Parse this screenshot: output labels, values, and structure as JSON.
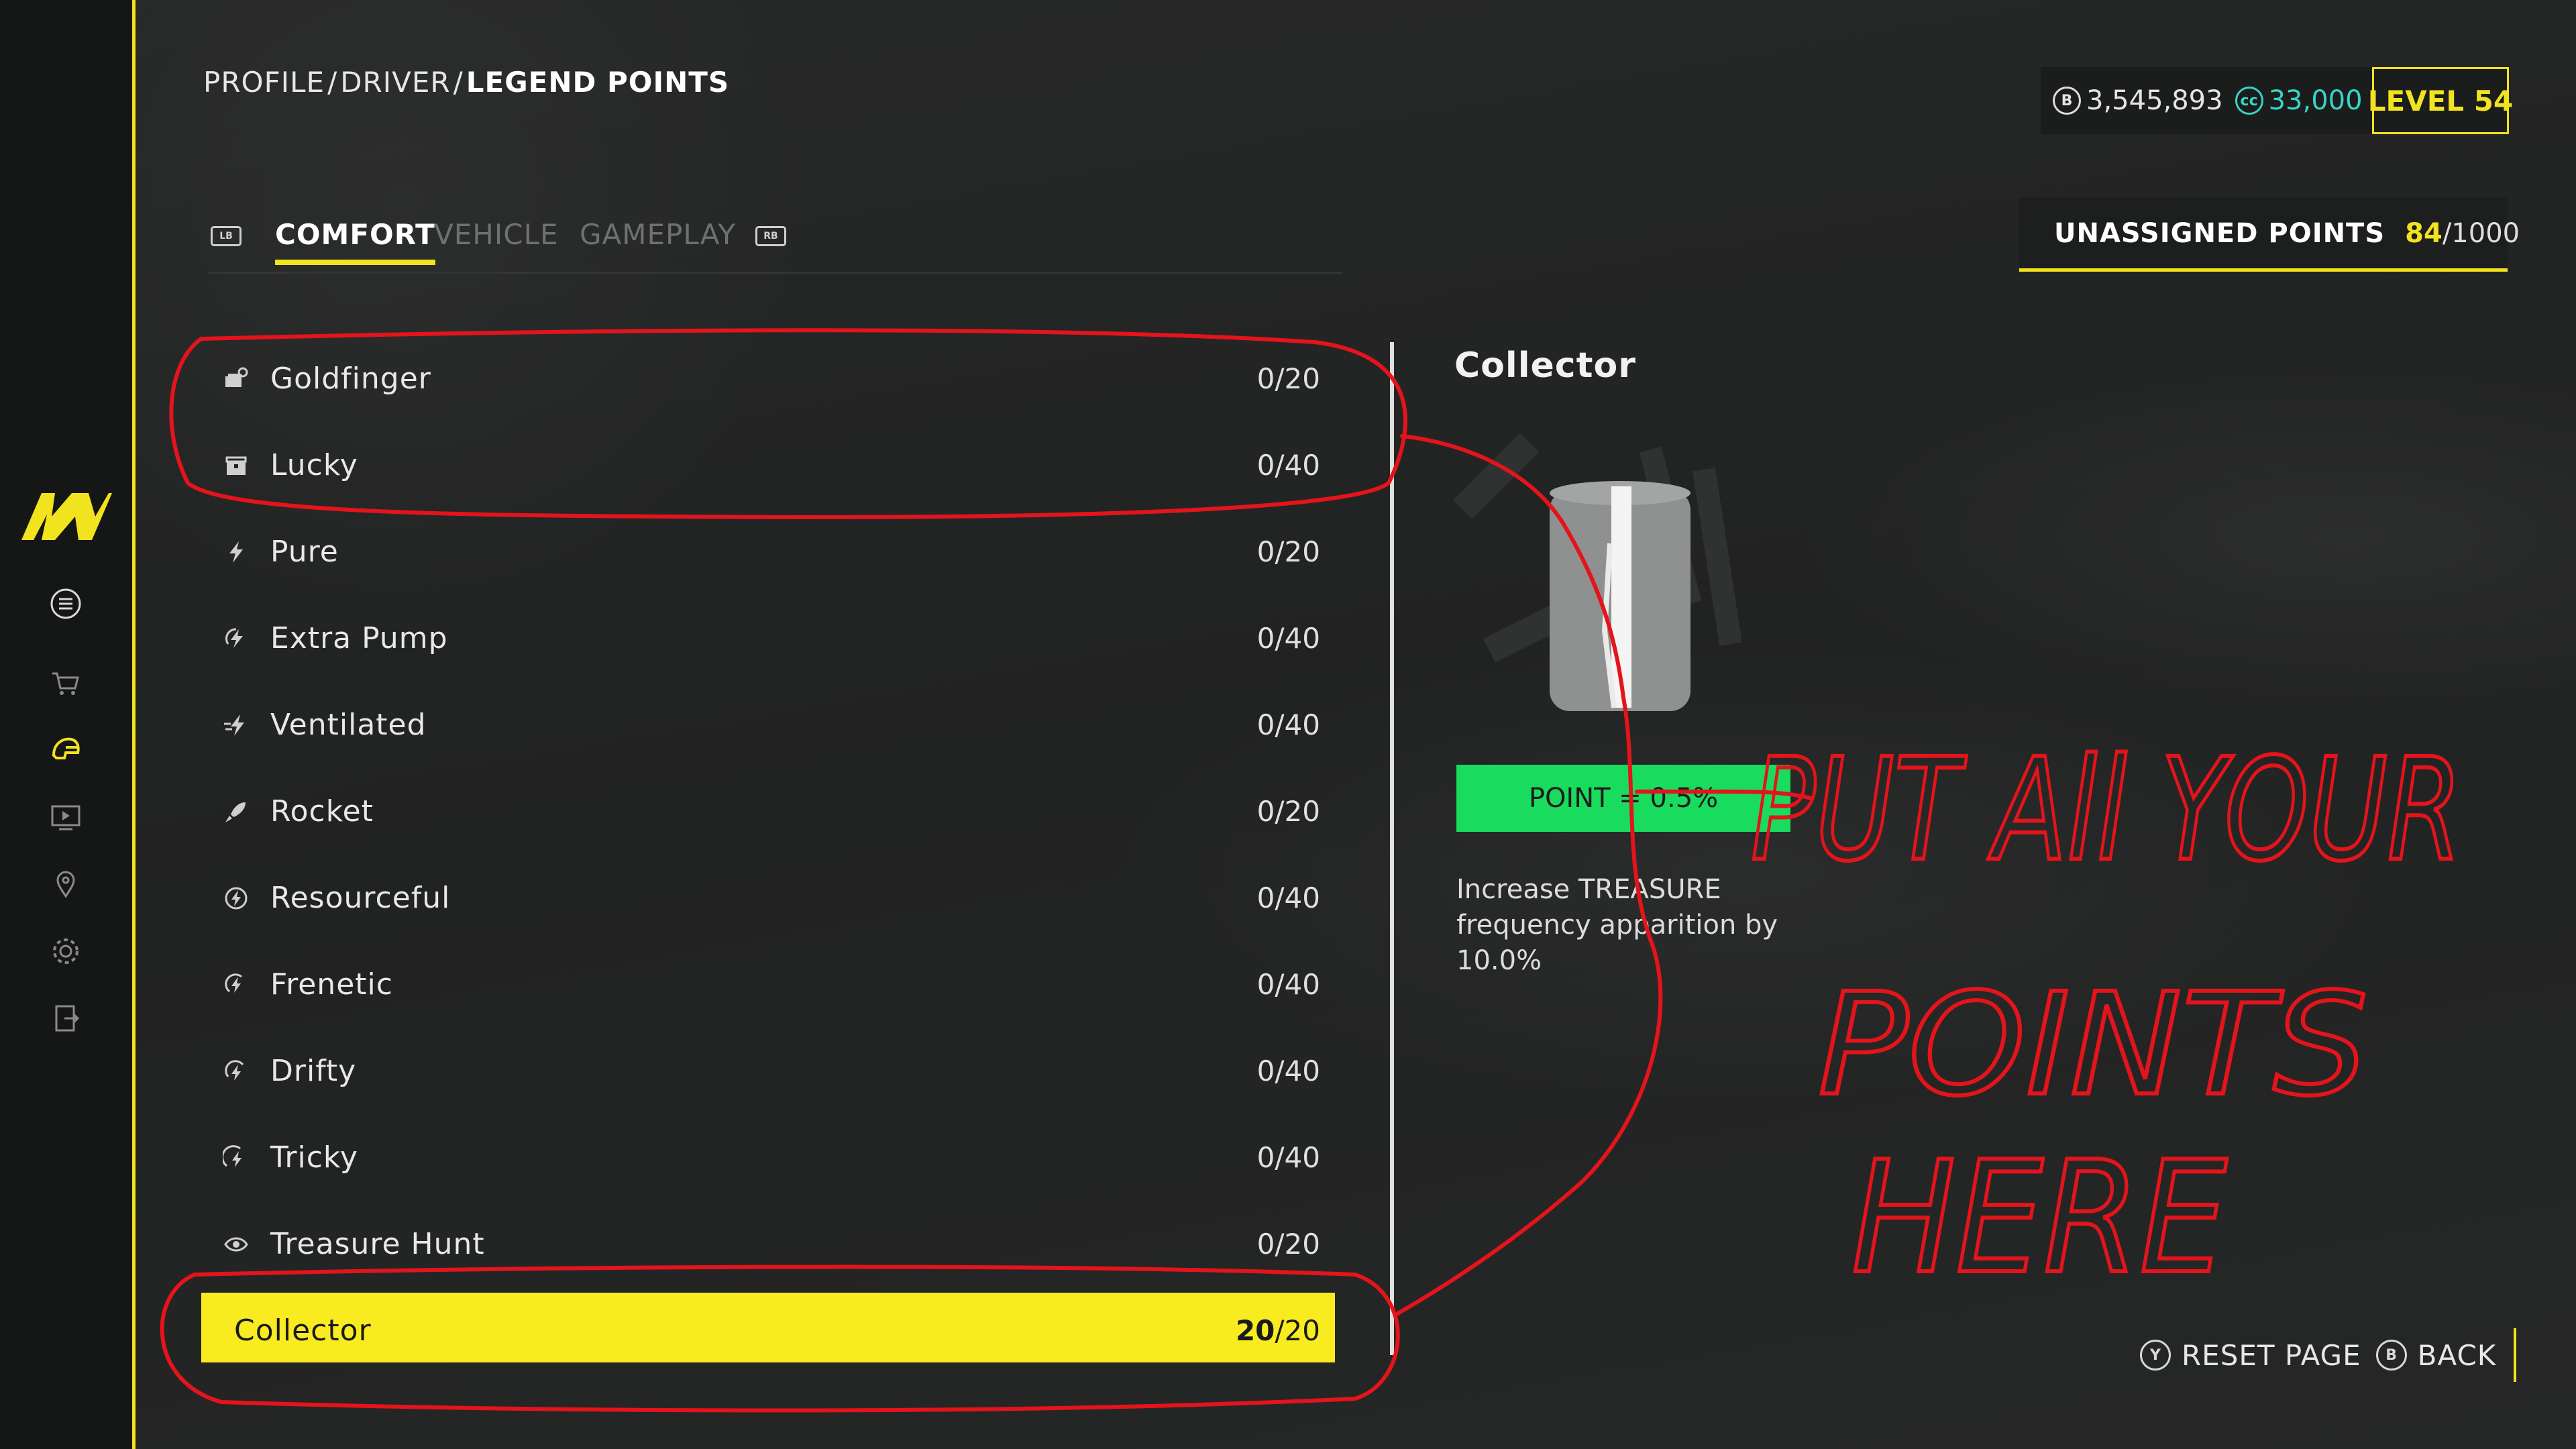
{
  "breadcrumb": {
    "part1": "PROFILE",
    "sep1": "/",
    "part2": "DRIVER",
    "sep2": "/",
    "current": "LEGEND POINTS"
  },
  "currency": {
    "bucks": "3,545,893",
    "bucks_icon": "B",
    "credits": "33,000",
    "credits_icon": "cc",
    "level": "LEVEL 54"
  },
  "unassigned": {
    "label": "UNASSIGNED POINTS",
    "value": "84",
    "total": "/1000"
  },
  "tabs": {
    "left_bumper": "LB",
    "right_bumper": "RB",
    "items": [
      {
        "label": "COMFORT"
      },
      {
        "label": "VEHICLE"
      },
      {
        "label": "GAMEPLAY"
      }
    ]
  },
  "perks": [
    {
      "name": "Goldfinger",
      "value": "0/20",
      "icon": "money-stack-icon"
    },
    {
      "name": "Lucky",
      "value": "0/40",
      "icon": "chest-icon"
    },
    {
      "name": "Pure",
      "value": "0/20",
      "icon": "lightning-icon"
    },
    {
      "name": "Extra Pump",
      "value": "0/40",
      "icon": "lightning-circle-icon"
    },
    {
      "name": "Ventilated",
      "value": "0/40",
      "icon": "lightning-wind-icon"
    },
    {
      "name": "Rocket",
      "value": "0/20",
      "icon": "rocket-icon"
    },
    {
      "name": "Resourceful",
      "value": "0/40",
      "icon": "lightning-ring-icon"
    },
    {
      "name": "Frenetic",
      "value": "0/40",
      "icon": "lightning-spin-icon"
    },
    {
      "name": "Drifty",
      "value": "0/40",
      "icon": "lightning-drift-icon"
    },
    {
      "name": "Tricky",
      "value": "0/40",
      "icon": "lightning-trick-icon"
    },
    {
      "name": "Treasure Hunt",
      "value": "0/20",
      "icon": "eye-icon"
    }
  ],
  "selected": {
    "name": "Collector",
    "current": "20",
    "max": "/20"
  },
  "detail": {
    "title": "Collector",
    "point_label": "POINT = 0.5%",
    "description": "Increase TREASURE frequency apparition by 10.0%"
  },
  "footer": {
    "reset_key": "Y",
    "reset_label": "RESET PAGE",
    "back_key": "B",
    "back_label": "BACK"
  },
  "annotation": {
    "line1": "PUT All YOUR",
    "line2": "POINTS",
    "line3": "HERE"
  },
  "colors": {
    "accent": "#f2e31f",
    "point_green": "#19dc5e",
    "teal": "#38d3c6",
    "annotation_red": "#e3141b"
  }
}
